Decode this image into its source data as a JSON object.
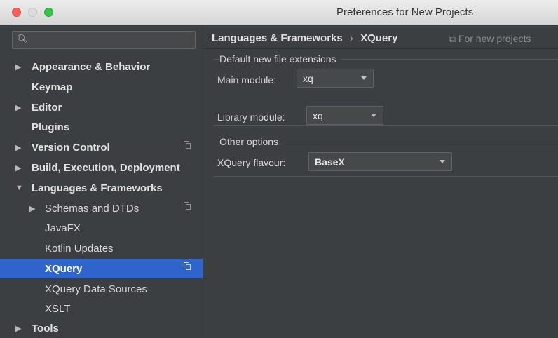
{
  "window": {
    "title": "Preferences for New Projects"
  },
  "search": {
    "placeholder": ""
  },
  "sidebar": {
    "items": [
      {
        "label": "Appearance & Behavior",
        "arrow": "▶"
      },
      {
        "label": "Keymap"
      },
      {
        "label": "Editor",
        "arrow": "▶"
      },
      {
        "label": "Plugins"
      },
      {
        "label": "Version Control",
        "arrow": "▶"
      },
      {
        "label": "Build, Execution, Deployment",
        "arrow": "▶"
      },
      {
        "label": "Languages & Frameworks",
        "arrow": "▼"
      },
      {
        "label": "Schemas and DTDs",
        "arrow": "▶"
      },
      {
        "label": "JavaFX"
      },
      {
        "label": "Kotlin Updates"
      },
      {
        "label": "XQuery",
        "selected": true
      },
      {
        "label": "XQuery Data Sources"
      },
      {
        "label": "XSLT"
      },
      {
        "label": "Tools",
        "arrow": "▶"
      }
    ]
  },
  "breadcrumb": {
    "parent": "Languages & Frameworks",
    "separator": "›",
    "current": "XQuery"
  },
  "scope_label": "For new projects",
  "groups": {
    "extensions": {
      "title": "Default new file extensions",
      "main_module_label": "Main module:",
      "main_module_value": "xq",
      "library_module_label": "Library module:",
      "library_module_value": "xq"
    },
    "other": {
      "title": "Other options",
      "flavour_label": "XQuery flavour:",
      "flavour_value": "BaseX"
    }
  },
  "colors": {
    "background": "#3c3f41",
    "selection": "#2f65ca",
    "traffic_red": "#fc5f57",
    "traffic_green": "#32c647"
  }
}
